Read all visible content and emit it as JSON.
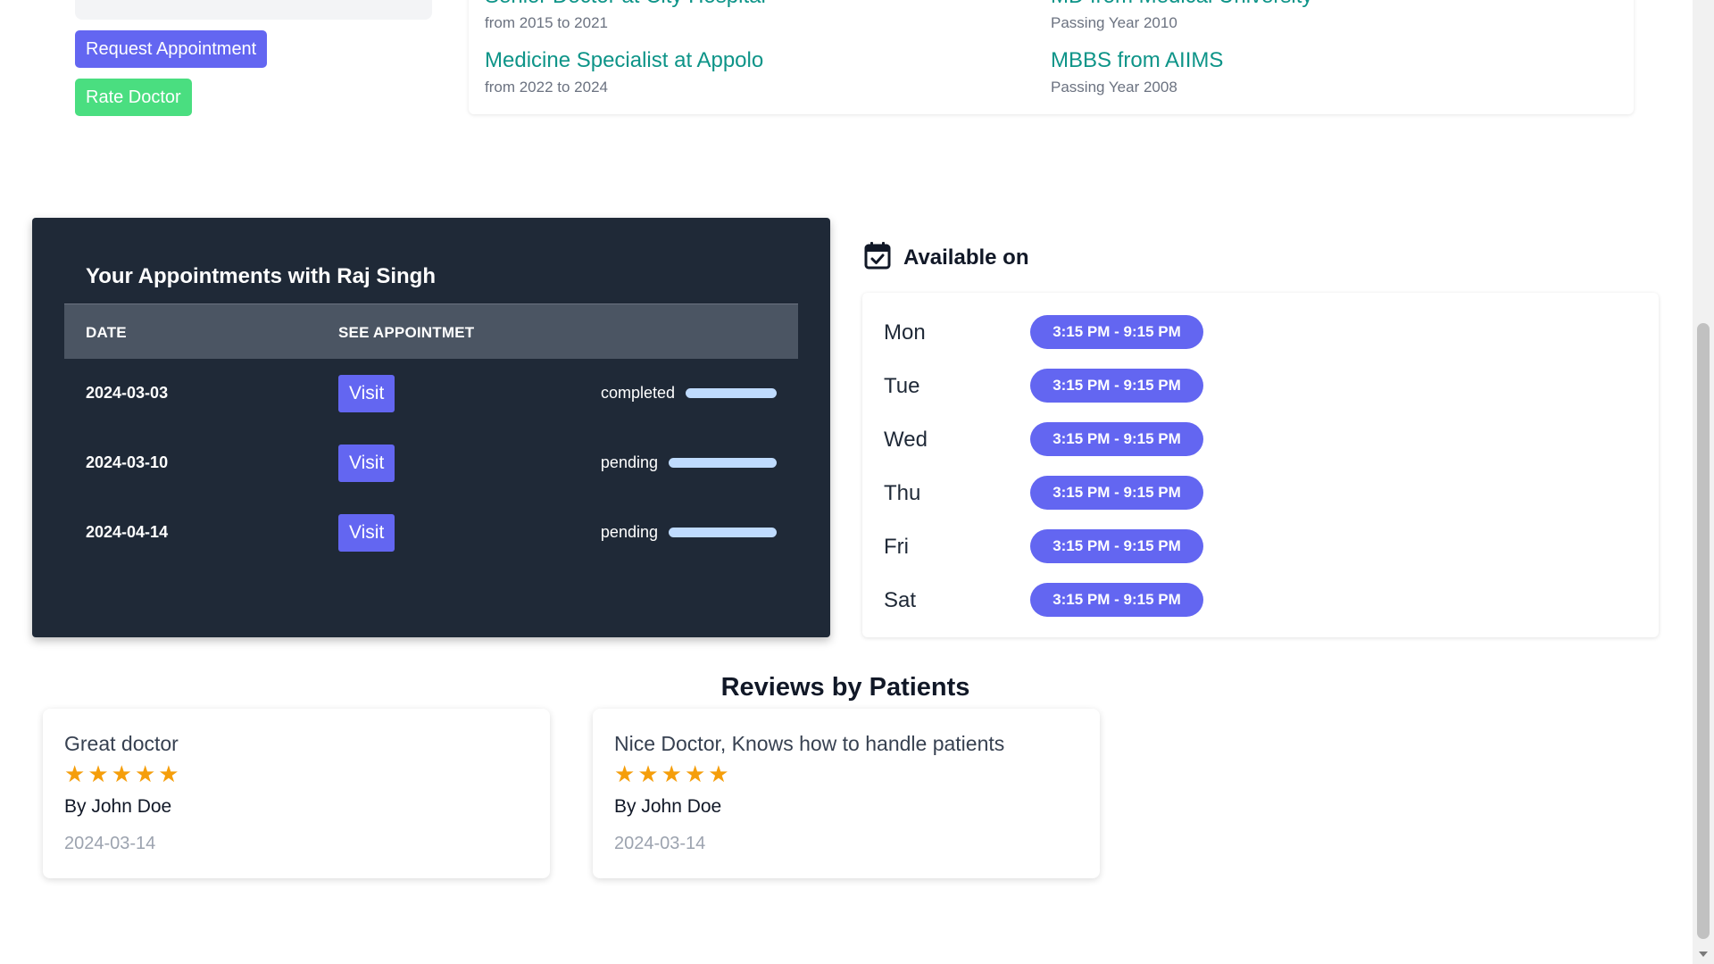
{
  "profile_actions": {
    "request_label": "Request Appointment",
    "rate_label": "Rate Doctor"
  },
  "experience": [
    {
      "title": "Senior Doctor at City Hospital",
      "sub": "from 2015 to 2021"
    },
    {
      "title": "Medicine Specialist at Appolo",
      "sub": "from 2022 to 2024"
    }
  ],
  "education": [
    {
      "title": "MD from Medical University",
      "sub": "Passing Year 2010"
    },
    {
      "title": "MBBS from AIIMS",
      "sub": "Passing Year 2008"
    }
  ],
  "appointments": {
    "title": "Your Appointments with Raj Singh",
    "col_date": "DATE",
    "col_see": "SEE APPOINTMET",
    "visit_label": "Visit",
    "rows": [
      {
        "date": "2024-03-03",
        "status": "completed"
      },
      {
        "date": "2024-03-10",
        "status": "pending"
      },
      {
        "date": "2024-04-14",
        "status": "pending"
      }
    ]
  },
  "availability": {
    "title": "Available on",
    "icon": "calendar-check-icon",
    "days": [
      {
        "day": "Mon",
        "time": "3:15 PM - 9:15 PM"
      },
      {
        "day": "Tue",
        "time": "3:15 PM - 9:15 PM"
      },
      {
        "day": "Wed",
        "time": "3:15 PM - 9:15 PM"
      },
      {
        "day": "Thu",
        "time": "3:15 PM - 9:15 PM"
      },
      {
        "day": "Fri",
        "time": "3:15 PM - 9:15 PM"
      },
      {
        "day": "Sat",
        "time": "3:15 PM - 9:15 PM"
      }
    ]
  },
  "reviews": {
    "title": "Reviews by Patients",
    "items": [
      {
        "text": "Great doctor",
        "rating": 5,
        "author": "By John Doe",
        "date": "2024-03-14"
      },
      {
        "text": "Nice Doctor, Knows how to handle patients",
        "rating": 5,
        "author": "By John Doe",
        "date": "2024-03-14"
      }
    ]
  },
  "colors": {
    "accent": "#6366f1",
    "rate_button": "#4ade80",
    "teal_link": "#0d9488",
    "dark_panel": "#1f2937",
    "star": "#f59e0b",
    "status_bar": "#bfdbfe"
  }
}
